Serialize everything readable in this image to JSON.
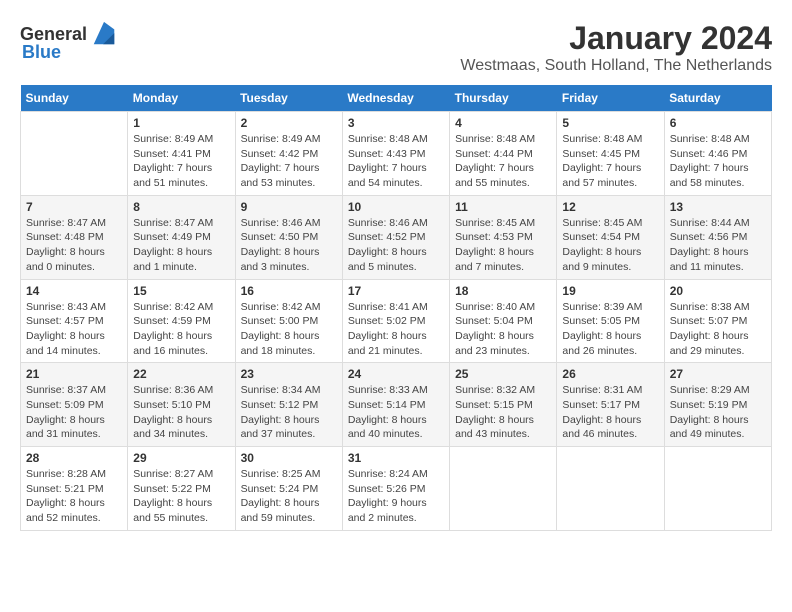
{
  "header": {
    "logo_general": "General",
    "logo_blue": "Blue",
    "title": "January 2024",
    "subtitle": "Westmaas, South Holland, The Netherlands"
  },
  "days_of_week": [
    "Sunday",
    "Monday",
    "Tuesday",
    "Wednesday",
    "Thursday",
    "Friday",
    "Saturday"
  ],
  "weeks": [
    [
      {
        "day": "",
        "content": ""
      },
      {
        "day": "1",
        "content": "Sunrise: 8:49 AM\nSunset: 4:41 PM\nDaylight: 7 hours\nand 51 minutes."
      },
      {
        "day": "2",
        "content": "Sunrise: 8:49 AM\nSunset: 4:42 PM\nDaylight: 7 hours\nand 53 minutes."
      },
      {
        "day": "3",
        "content": "Sunrise: 8:48 AM\nSunset: 4:43 PM\nDaylight: 7 hours\nand 54 minutes."
      },
      {
        "day": "4",
        "content": "Sunrise: 8:48 AM\nSunset: 4:44 PM\nDaylight: 7 hours\nand 55 minutes."
      },
      {
        "day": "5",
        "content": "Sunrise: 8:48 AM\nSunset: 4:45 PM\nDaylight: 7 hours\nand 57 minutes."
      },
      {
        "day": "6",
        "content": "Sunrise: 8:48 AM\nSunset: 4:46 PM\nDaylight: 7 hours\nand 58 minutes."
      }
    ],
    [
      {
        "day": "7",
        "content": "Sunrise: 8:47 AM\nSunset: 4:48 PM\nDaylight: 8 hours\nand 0 minutes."
      },
      {
        "day": "8",
        "content": "Sunrise: 8:47 AM\nSunset: 4:49 PM\nDaylight: 8 hours\nand 1 minute."
      },
      {
        "day": "9",
        "content": "Sunrise: 8:46 AM\nSunset: 4:50 PM\nDaylight: 8 hours\nand 3 minutes."
      },
      {
        "day": "10",
        "content": "Sunrise: 8:46 AM\nSunset: 4:52 PM\nDaylight: 8 hours\nand 5 minutes."
      },
      {
        "day": "11",
        "content": "Sunrise: 8:45 AM\nSunset: 4:53 PM\nDaylight: 8 hours\nand 7 minutes."
      },
      {
        "day": "12",
        "content": "Sunrise: 8:45 AM\nSunset: 4:54 PM\nDaylight: 8 hours\nand 9 minutes."
      },
      {
        "day": "13",
        "content": "Sunrise: 8:44 AM\nSunset: 4:56 PM\nDaylight: 8 hours\nand 11 minutes."
      }
    ],
    [
      {
        "day": "14",
        "content": "Sunrise: 8:43 AM\nSunset: 4:57 PM\nDaylight: 8 hours\nand 14 minutes."
      },
      {
        "day": "15",
        "content": "Sunrise: 8:42 AM\nSunset: 4:59 PM\nDaylight: 8 hours\nand 16 minutes."
      },
      {
        "day": "16",
        "content": "Sunrise: 8:42 AM\nSunset: 5:00 PM\nDaylight: 8 hours\nand 18 minutes."
      },
      {
        "day": "17",
        "content": "Sunrise: 8:41 AM\nSunset: 5:02 PM\nDaylight: 8 hours\nand 21 minutes."
      },
      {
        "day": "18",
        "content": "Sunrise: 8:40 AM\nSunset: 5:04 PM\nDaylight: 8 hours\nand 23 minutes."
      },
      {
        "day": "19",
        "content": "Sunrise: 8:39 AM\nSunset: 5:05 PM\nDaylight: 8 hours\nand 26 minutes."
      },
      {
        "day": "20",
        "content": "Sunrise: 8:38 AM\nSunset: 5:07 PM\nDaylight: 8 hours\nand 29 minutes."
      }
    ],
    [
      {
        "day": "21",
        "content": "Sunrise: 8:37 AM\nSunset: 5:09 PM\nDaylight: 8 hours\nand 31 minutes."
      },
      {
        "day": "22",
        "content": "Sunrise: 8:36 AM\nSunset: 5:10 PM\nDaylight: 8 hours\nand 34 minutes."
      },
      {
        "day": "23",
        "content": "Sunrise: 8:34 AM\nSunset: 5:12 PM\nDaylight: 8 hours\nand 37 minutes."
      },
      {
        "day": "24",
        "content": "Sunrise: 8:33 AM\nSunset: 5:14 PM\nDaylight: 8 hours\nand 40 minutes."
      },
      {
        "day": "25",
        "content": "Sunrise: 8:32 AM\nSunset: 5:15 PM\nDaylight: 8 hours\nand 43 minutes."
      },
      {
        "day": "26",
        "content": "Sunrise: 8:31 AM\nSunset: 5:17 PM\nDaylight: 8 hours\nand 46 minutes."
      },
      {
        "day": "27",
        "content": "Sunrise: 8:29 AM\nSunset: 5:19 PM\nDaylight: 8 hours\nand 49 minutes."
      }
    ],
    [
      {
        "day": "28",
        "content": "Sunrise: 8:28 AM\nSunset: 5:21 PM\nDaylight: 8 hours\nand 52 minutes."
      },
      {
        "day": "29",
        "content": "Sunrise: 8:27 AM\nSunset: 5:22 PM\nDaylight: 8 hours\nand 55 minutes."
      },
      {
        "day": "30",
        "content": "Sunrise: 8:25 AM\nSunset: 5:24 PM\nDaylight: 8 hours\nand 59 minutes."
      },
      {
        "day": "31",
        "content": "Sunrise: 8:24 AM\nSunset: 5:26 PM\nDaylight: 9 hours\nand 2 minutes."
      },
      {
        "day": "",
        "content": ""
      },
      {
        "day": "",
        "content": ""
      },
      {
        "day": "",
        "content": ""
      }
    ]
  ]
}
